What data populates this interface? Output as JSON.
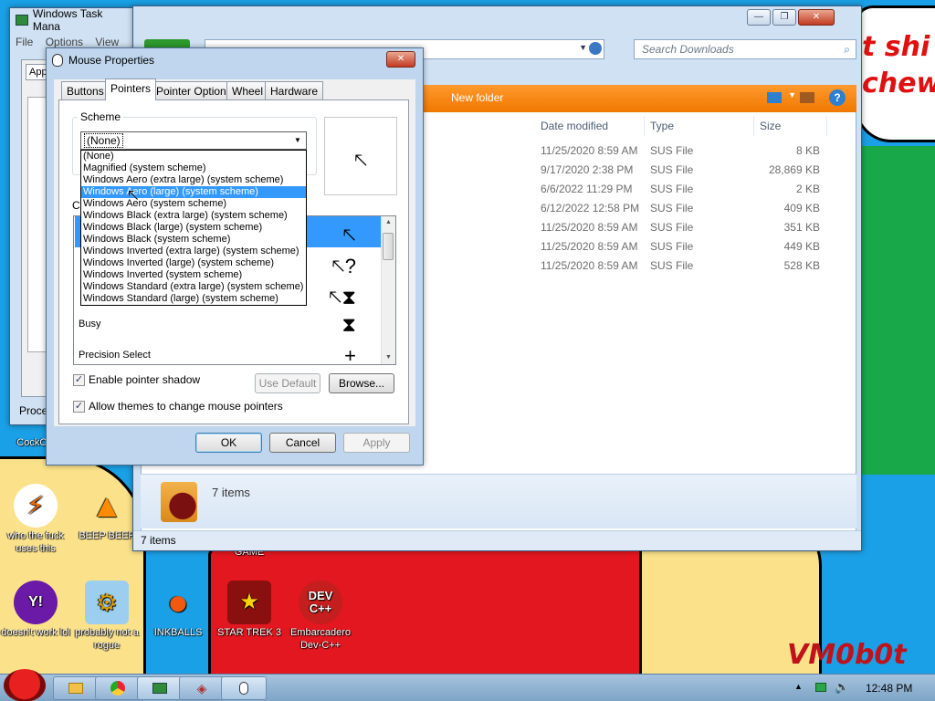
{
  "wallpaper": {
    "bubble_line1": "t shi",
    "bubble_line2": "chew",
    "signature": "VM0b0t"
  },
  "desktop_icons": [
    {
      "label": "CockCle",
      "glyph": "⚙"
    },
    {
      "label": "who the fuck uses this",
      "glyph": "⚡"
    },
    {
      "label": "BEEP BEEP",
      "glyph": "▲"
    },
    {
      "label": "GAME",
      "glyph": ""
    },
    {
      "label": "doesn't work lol",
      "glyph": "Y!"
    },
    {
      "label": "probably not a rogue",
      "glyph": "⚙"
    },
    {
      "label": "INKBALLS",
      "glyph": "●"
    },
    {
      "label": "STAR TREK 3",
      "glyph": "★"
    },
    {
      "label": "Embarcadero Dev-C++",
      "glyph": "DEV C++"
    }
  ],
  "taskmgr": {
    "title": "Windows Task Mana",
    "menu": [
      "File",
      "Options",
      "View"
    ],
    "tab": "App",
    "status": "Proce"
  },
  "explorer": {
    "search_placeholder": "Search Downloads",
    "new_folder": "New folder",
    "columns": [
      "Date modified",
      "Type",
      "Size"
    ],
    "files": [
      {
        "date": "11/25/2020 8:59 AM",
        "type": "SUS File",
        "size": "8 KB"
      },
      {
        "date": "9/17/2020 2:38 PM",
        "type": "SUS File",
        "size": "28,869 KB"
      },
      {
        "date": "6/6/2022 11:29 PM",
        "type": "SUS File",
        "size": "2 KB"
      },
      {
        "date": "6/12/2022 12:58 PM",
        "type": "SUS File",
        "size": "409 KB"
      },
      {
        "date": "11/25/2020 8:59 AM",
        "type": "SUS File",
        "size": "351 KB"
      },
      {
        "date": "11/25/2020 8:59 AM",
        "type": "SUS File",
        "size": "449 KB"
      },
      {
        "date": "11/25/2020 8:59 AM",
        "type": "SUS File",
        "size": "528 KB"
      }
    ],
    "details_count": "7 items",
    "status_count": "7 items"
  },
  "mouse": {
    "title": "Mouse Properties",
    "tabs": [
      "Buttons",
      "Pointers",
      "Pointer Options",
      "Wheel",
      "Hardware"
    ],
    "scheme_label": "Scheme",
    "scheme_value": "(None)",
    "scheme_options": [
      "(None)",
      "Magnified (system scheme)",
      "Windows Aero (extra large) (system scheme)",
      "Windows Aero (large) (system scheme)",
      "Windows Aero (system scheme)",
      "Windows Black (extra large) (system scheme)",
      "Windows Black (large) (system scheme)",
      "Windows Black (system scheme)",
      "Windows Inverted (extra large) (system scheme)",
      "Windows Inverted (large) (system scheme)",
      "Windows Inverted (system scheme)",
      "Windows Standard (extra large) (system scheme)",
      "Windows Standard (large) (system scheme)"
    ],
    "highlighted_index": 3,
    "customize_label": "C",
    "cursor_rows": [
      {
        "label": "",
        "glyph": "🡔"
      },
      {
        "label": "",
        "glyph": "🡔?"
      },
      {
        "label": "",
        "glyph": "🡔⧗"
      },
      {
        "label": "Busy",
        "glyph": "⧗"
      },
      {
        "label": "Precision Select",
        "glyph": "+"
      }
    ],
    "shadow_label": "Enable pointer shadow",
    "shadow_checked": true,
    "use_default": "Use Default",
    "browse": "Browse...",
    "themes_label": "Allow themes to change mouse pointers",
    "themes_checked": true,
    "ok": "OK",
    "cancel": "Cancel",
    "apply": "Apply"
  },
  "taskbar": {
    "clock": "12:48 PM"
  }
}
